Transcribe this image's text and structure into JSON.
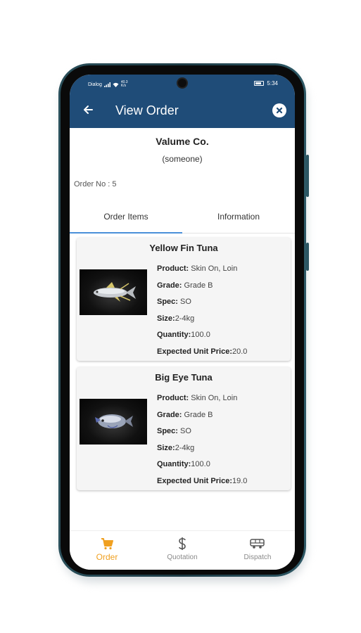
{
  "status": {
    "carrier": "Dialog",
    "net_speed": "40.3 K/s",
    "time": "5:34"
  },
  "appbar": {
    "title": "View Order",
    "back_icon": "arrow-back-icon",
    "close_icon": "close-circle-icon"
  },
  "order": {
    "company": "Valume Co.",
    "contact": "(someone)",
    "order_no": "Order No : 5"
  },
  "tabs": [
    {
      "label": "Order Items",
      "active": true
    },
    {
      "label": "Information",
      "active": false
    }
  ],
  "items": [
    {
      "title": "Yellow Fin Tuna",
      "product_label": "Product:",
      "product": " Skin On, Loin",
      "grade_label": "Grade:",
      "grade": " Grade B",
      "spec_label": "Spec:",
      "spec": " SO",
      "size_label": "Size:",
      "size": "2-4kg",
      "quantity_label": "Quantity:",
      "quantity": "100.0",
      "price_label": "Expected Unit Price:",
      "price": "20.0"
    },
    {
      "title": "Big Eye Tuna",
      "product_label": "Product:",
      "product": " Skin On, Loin",
      "grade_label": "Grade:",
      "grade": " Grade B",
      "spec_label": "Spec:",
      "spec": " SO",
      "size_label": "Size:",
      "size": "2-4kg",
      "quantity_label": "Quantity:",
      "quantity": "100.0",
      "price_label": "Expected Unit Price:",
      "price": "19.0"
    }
  ],
  "bottom_nav": [
    {
      "label": "Order",
      "icon": "cart-icon",
      "active": true
    },
    {
      "label": "Quotation",
      "icon": "dollar-icon",
      "active": false
    },
    {
      "label": "Dispatch",
      "icon": "truck-icon",
      "active": false
    }
  ],
  "colors": {
    "primary": "#1f4c78",
    "active_nav": "#f0a020",
    "tab_indicator": "#4a90d9"
  }
}
